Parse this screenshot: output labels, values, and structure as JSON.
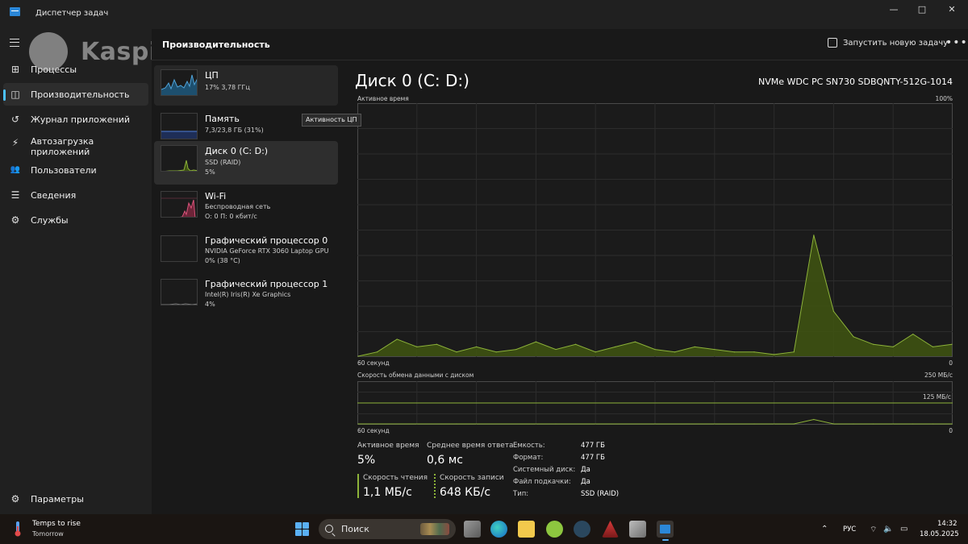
{
  "window": {
    "title": "Диспетчер задач",
    "controls": {
      "minimize": "—",
      "maximize": "□",
      "close": "✕"
    }
  },
  "watermark": {
    "text": "Kaspi.kz"
  },
  "nav": {
    "items": [
      {
        "label": "Процессы",
        "icon": "grid-icon",
        "glyph": "⊞"
      },
      {
        "label": "Производительность",
        "icon": "performance-icon",
        "glyph": "◫",
        "active": true
      },
      {
        "label": "Журнал приложений",
        "icon": "history-icon",
        "glyph": "↺"
      },
      {
        "label": "Автозагрузка приложений",
        "icon": "startup-icon",
        "glyph": "⚡"
      },
      {
        "label": "Пользователи",
        "icon": "users-icon",
        "glyph": "👥"
      },
      {
        "label": "Сведения",
        "icon": "details-icon",
        "glyph": "☰"
      },
      {
        "label": "Службы",
        "icon": "services-icon",
        "glyph": "⚙"
      }
    ],
    "settings": {
      "label": "Параметры",
      "icon": "gear-icon",
      "glyph": "⚙"
    }
  },
  "header": {
    "title": "Производительность",
    "run_task": "Запустить новую задачу",
    "more": "•••"
  },
  "perf_list": [
    {
      "name": "ЦП",
      "sub1": "17% 3,78 ГГц",
      "sub2": "",
      "color": "#4fa3d9"
    },
    {
      "name": "Память",
      "sub1": "7,3/23,8 ГБ (31%)",
      "sub2": "",
      "color": "#4f7fd9"
    },
    {
      "name": "Диск 0 (C: D:)",
      "sub1": "SSD (RAID)",
      "sub2": "5%",
      "color": "#8db339",
      "selected": true
    },
    {
      "name": "Wi-Fi",
      "sub1": "Беспроводная сеть",
      "sub2": "О: 0 П: 0 кбит/с",
      "color": "#d9537a"
    },
    {
      "name": "Графический процессор 0",
      "sub1": "NVIDIA GeForce RTX 3060 Laptop GPU",
      "sub2": "0% (38 °C)",
      "color": "#7a7a7a"
    },
    {
      "name": "Графический процессор 1",
      "sub1": "Intel(R) Iris(R) Xe Graphics",
      "sub2": "4%",
      "color": "#7a7a7a"
    }
  ],
  "tooltip": "Активность ЦП",
  "detail": {
    "title": "Диск 0 (C: D:)",
    "model": "NVMe WDC PC SN730 SDBQNTY-512G-1014",
    "active_time_label": "Активное время",
    "active_time_max": "100%",
    "x_left": "60 секунд",
    "x_right": "0",
    "transfer_label": "Скорость обмена данными с диском",
    "transfer_max": "250 МБ/с",
    "transfer_mid": "125 МБ/с",
    "x2_left": "60 секунд",
    "x2_right": "0",
    "accent": "#8db339"
  },
  "stats": {
    "active_time": {
      "label": "Активное время",
      "value": "5%"
    },
    "avg_response": {
      "label": "Среднее время ответа",
      "value": "0,6 мс"
    },
    "read_speed": {
      "label": "Скорость чтения",
      "value": "1,1 МБ/с"
    },
    "write_speed": {
      "label": "Скорость записи",
      "value": "648 КБ/с"
    }
  },
  "props": [
    {
      "label": "Емкость:",
      "value": "477 ГБ"
    },
    {
      "label": "Формат:",
      "value": "477 ГБ"
    },
    {
      "label": "Системный диск:",
      "value": "Да"
    },
    {
      "label": "Файл подкачки:",
      "value": "Да"
    },
    {
      "label": "Тип:",
      "value": "SSD (RAID)"
    }
  ],
  "chart_data": [
    {
      "type": "area",
      "ylabel": "Активное время",
      "x": [
        60,
        58,
        56,
        54,
        52,
        50,
        48,
        46,
        44,
        42,
        40,
        38,
        36,
        34,
        32,
        30,
        28,
        26,
        24,
        22,
        20,
        18,
        16,
        14,
        12,
        10,
        8,
        6,
        4,
        2,
        0
      ],
      "values": [
        0,
        2,
        7,
        4,
        5,
        2,
        4,
        2,
        3,
        6,
        3,
        5,
        2,
        4,
        6,
        3,
        2,
        4,
        3,
        2,
        2,
        1,
        2,
        48,
        18,
        8,
        5,
        4,
        9,
        4,
        5
      ],
      "ylim": [
        0,
        100
      ]
    },
    {
      "type": "line",
      "ylabel": "Скорость обмена данными с диском",
      "x": [
        60,
        50,
        40,
        30,
        20,
        16,
        14,
        12,
        10,
        8,
        6,
        4,
        2,
        0
      ],
      "values": [
        0.3,
        0.3,
        0.3,
        0.3,
        0.4,
        0.5,
        30,
        3,
        1.2,
        0.8,
        0.7,
        1.4,
        2.5,
        0.6
      ],
      "ylim": [
        0,
        250
      ]
    }
  ],
  "taskbar": {
    "weather_title": "Temps to rise",
    "weather_sub": "Tomorrow",
    "search_placeholder": "Поиск",
    "language": "РУС",
    "time": "14:32",
    "date": "18.05.2025"
  }
}
